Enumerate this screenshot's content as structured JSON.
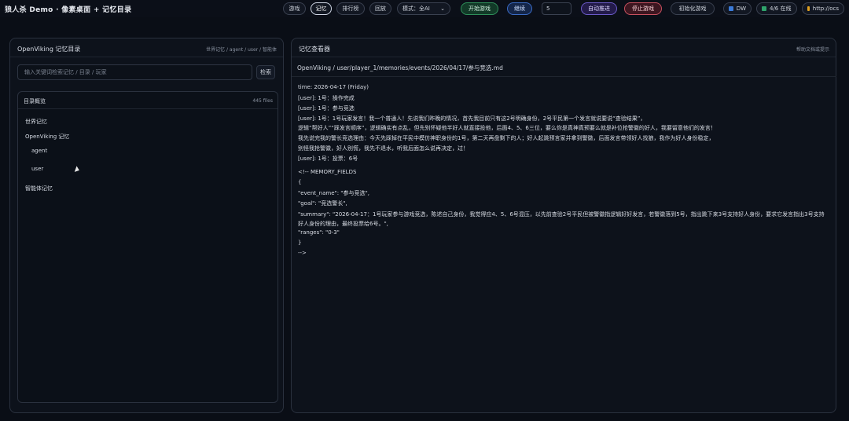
{
  "app": {
    "title": "狼人杀 Demo · 像素桌面 + 记忆目录"
  },
  "toolbar": {
    "tabs": [
      "游戏",
      "记忆",
      "排行榜",
      "回放"
    ],
    "active_tab": "记忆",
    "mode_select": {
      "value": "模式：全AI",
      "icon": "chevron-down-icon"
    },
    "start_button": "开始游戏",
    "next_button": "继续",
    "step_input": "5",
    "autoplay_button": "自动推进",
    "stop_button": "停止游戏",
    "init_button": "初始化游戏",
    "status": [
      {
        "label": "DW",
        "color": "#3b7bd8",
        "icon": "square-icon"
      },
      {
        "label": "4/6 在线",
        "color": "#2fa36b",
        "icon": "square-icon"
      },
      {
        "label": "http://ocs",
        "color": "#e0a020",
        "icon": "square-icon"
      }
    ]
  },
  "left_panel": {
    "title": "OpenViking 记忆目录",
    "breadcrumb": "世界记忆 / agent / user / 智能体",
    "search_placeholder": "输入关键词检索记忆 / 目录 / 玩家",
    "search_button": "检索",
    "tree": {
      "title": "目录概览",
      "count": "445 files",
      "items": [
        "世界记忆",
        "OpenViking 记忆",
        "agent",
        "user",
        "智能体记忆"
      ]
    }
  },
  "right_panel": {
    "title": "记忆查看器",
    "hint": "帮助文档或提示",
    "path": "OpenViking / user/player_1/memories/events/2026/04/17/参与竞选.md",
    "lines": [
      "time: 2026-04-17 (Friday)",
      "[user]: 1号：操作完成",
      "[user]: 1号：参与竞选",
      "[user]: 1号：1号玩家发言！我一个普通人！先说我们昨晚的情况，首先我目前只有这2号明确身份，2号平民第一个发言就说要说“查验结果”，",
      "逻辑“帮好人”“踩发言顺序”，逻辑确实有点乱，但先别怀疑他半好人就直接投他，后面4、5、6三位，要么你是真神真预要么就是补位抢警徽的好人，我要留意他们的发言！",
      "我先说完我的警长竞选理由：今天先踩掉在平民中模仿神职身份的1号，第二天再盘剩下的人；好人起跳预言家并拿到警徽，后面发言带领好人找狼，我作为好人身份稳定，",
      "别怪我抢警徽，好人别慌，我先不退水，听我后面怎么说再决定，过！",
      "[user]: 1号：投票：6号",
      "",
      "<!-- MEMORY_FIELDS",
      "{",
      "\"event_name\": \"参与竞选\",",
      "\"goal\": \"竞选警长\",",
      "\"summary\": \"2026-04-17：1号玩家参与游戏竞选，陈述自己身份，我觉得应4、5、6号混压，以先前查验2号平民但被警徽指逻辑好好发言，若警徽落到5号，指出跳下来3号支持好人身份，要求它发言指出3号支持好人身份的理由，最终投票给6号。\",",
      "\"ranges\": \"0-3\"",
      "}",
      "-->"
    ]
  }
}
